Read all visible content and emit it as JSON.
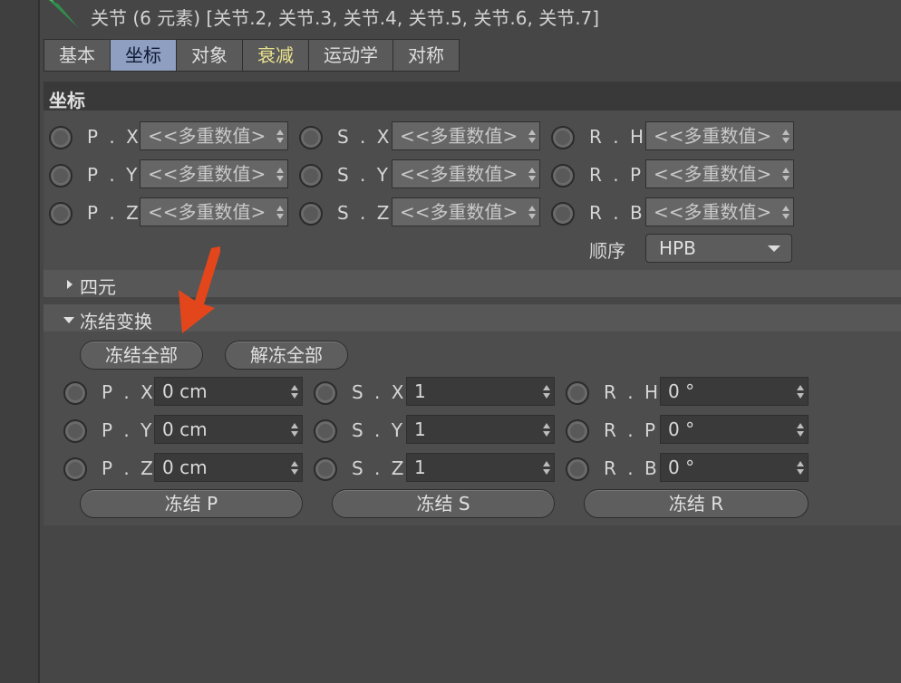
{
  "header": {
    "title": "关节 (6 元素) [关节.2, 关节.3, 关节.4, 关节.5, 关节.6, 关节.7]",
    "icon": "joint-icon"
  },
  "tabs": [
    {
      "label": "基本",
      "active": false
    },
    {
      "label": "坐标",
      "active": true
    },
    {
      "label": "对象",
      "active": false
    },
    {
      "label": "衰减",
      "active": false
    },
    {
      "label": "运动学",
      "active": false
    },
    {
      "label": "对称",
      "active": false
    }
  ],
  "coords": {
    "section_title": "坐标",
    "rows": [
      {
        "p_label": "P . X",
        "p_value": "<<多重数值>",
        "s_label": "S . X",
        "s_value": "<<多重数值>",
        "r_label": "R . H",
        "r_value": "<<多重数值>"
      },
      {
        "p_label": "P . Y",
        "p_value": "<<多重数值>",
        "s_label": "S . Y",
        "s_value": "<<多重数值>",
        "r_label": "R . P",
        "r_value": "<<多重数值>"
      },
      {
        "p_label": "P . Z",
        "p_value": "<<多重数值>",
        "s_label": "S . Z",
        "s_value": "<<多重数值>",
        "r_label": "R . B",
        "r_value": "<<多重数值>"
      }
    ],
    "order_label": "顺序",
    "order_value": "HPB"
  },
  "quaternion": {
    "label": "四元"
  },
  "freeze": {
    "label": "冻结变换",
    "freeze_all": "冻结全部",
    "unfreeze_all": "解冻全部",
    "rows": [
      {
        "p_label": "P . X",
        "p_value": "0 cm",
        "s_label": "S . X",
        "s_value": "1",
        "r_label": "R . H",
        "r_value": "0 °"
      },
      {
        "p_label": "P . Y",
        "p_value": "0 cm",
        "s_label": "S . Y",
        "s_value": "1",
        "r_label": "R . P",
        "r_value": "0 °"
      },
      {
        "p_label": "P . Z",
        "p_value": "0 cm",
        "s_label": "S . Z",
        "s_value": "1",
        "r_label": "R . B",
        "r_value": "0 °"
      }
    ],
    "freeze_p": "冻结 P",
    "freeze_s": "冻结 S",
    "freeze_r": "冻结 R"
  },
  "colors": {
    "accent_tab": "#8f9fc1",
    "annotation_arrow": "#e4461b"
  }
}
